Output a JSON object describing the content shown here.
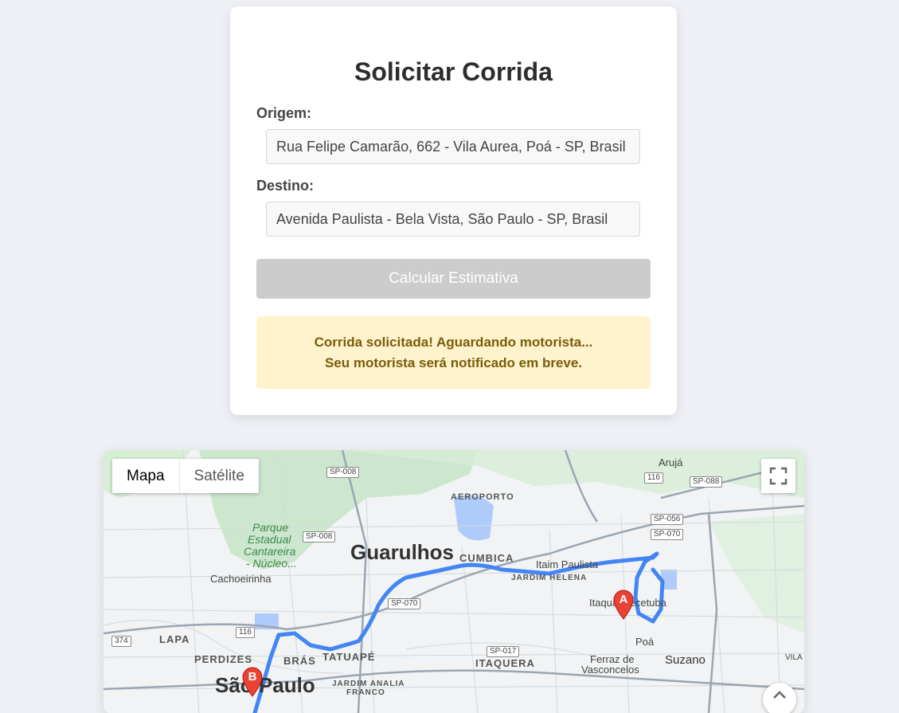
{
  "form": {
    "title": "Solicitar Corrida",
    "origin_label": "Origem:",
    "origin_value": "Rua Felipe Camarão, 662 - Vila Aurea, Poá - SP, Brasil",
    "destination_label": "Destino:",
    "destination_value": "Avenida Paulista - Bela Vista, São Paulo - SP, Brasil",
    "button_label": "Calcular Estimativa",
    "status_line1": "Corrida solicitada! Aguardando motorista...",
    "status_line2": "Seu motorista será notificado em breve."
  },
  "map": {
    "type_map": "Mapa",
    "type_satellite": "Satélite",
    "marker_a": "A",
    "marker_b": "B",
    "route_color": "#4285f4",
    "labels": {
      "guarulhos": "Guarulhos",
      "sao_paulo": "São Paulo",
      "aruja": "Arujá",
      "aeroporto": "AEROPORTO",
      "cumbica": "CUMBICA",
      "itaim": "Itaim Paulista",
      "jardim_helena": "JARDIM HELENA",
      "itaquaquecetuba": "Itaquaquecetuba",
      "poa": "Poá",
      "ferraz": "Ferraz de",
      "vasconcelos": "Vasconcelos",
      "suzano": "Suzano",
      "itaquera": "ITAQUERA",
      "tatuape": "TATUAPÉ",
      "bras": "BRÁS",
      "perdizes": "PERDIZES",
      "lapa": "LAPA",
      "cachoeirinha": "Cachoeirinha",
      "jardim_analia": "JARDIM ANALIA",
      "franco": "FRANCO",
      "park1": "Parque",
      "park2": "Estadual",
      "park3": "Cantareira",
      "park4": "- Núcleo...",
      "vila": "VILA"
    },
    "shields": {
      "sp008a": "SP-008",
      "sp008b": "SP-008",
      "r116a": "116",
      "sp088": "SP-088",
      "sp056": "SP-056",
      "sp070a": "SP-070",
      "sp070b": "SP-070",
      "r116b": "116",
      "r374": "374",
      "sp017": "SP-017"
    }
  }
}
